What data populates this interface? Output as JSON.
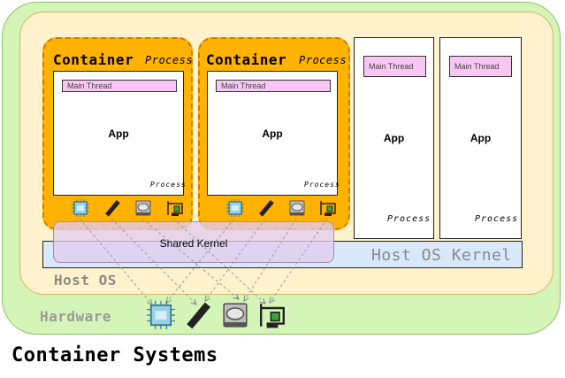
{
  "layers": {
    "hardware": "Hardware",
    "host_os": "Host OS",
    "kernel": "Host OS Kernel",
    "shared_kernel": "Shared Kernel"
  },
  "containers": [
    {
      "title": "Container",
      "process": "Process",
      "thread": "Main Thread",
      "app": "App",
      "inner_process": "Process"
    },
    {
      "title": "Container",
      "process": "Process",
      "thread": "Main Thread",
      "app": "App",
      "inner_process": "Process"
    }
  ],
  "processes": [
    {
      "thread": "Main Thread",
      "app": "App",
      "process": "Process"
    },
    {
      "thread": "Main Thread",
      "app": "App",
      "process": "Process"
    }
  ],
  "footer_title": "Container Systems",
  "icons": [
    "cpu-icon",
    "ram-icon",
    "disk-icon",
    "network-card-icon"
  ]
}
